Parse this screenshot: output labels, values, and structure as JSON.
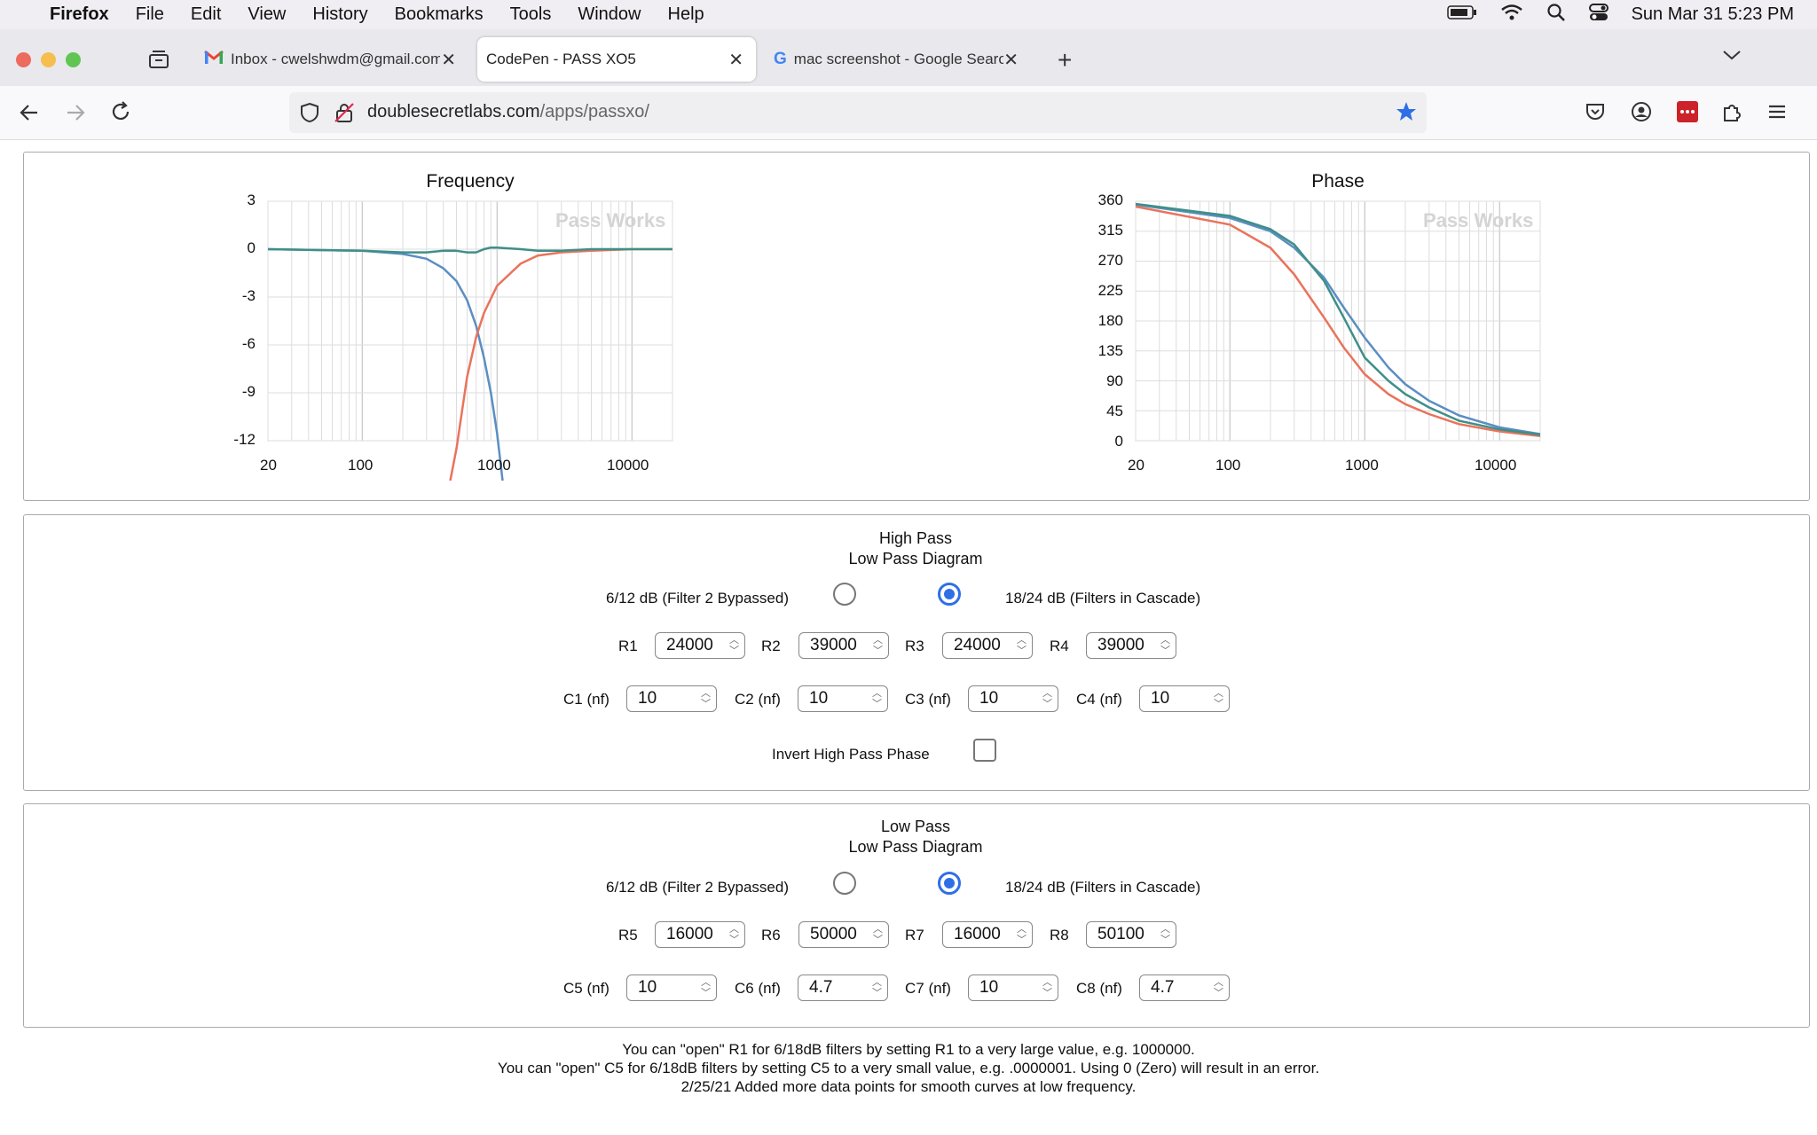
{
  "menubar": {
    "app": "Firefox",
    "items": [
      "File",
      "Edit",
      "View",
      "History",
      "Bookmarks",
      "Tools",
      "Window",
      "Help"
    ],
    "clock": "Sun Mar 31  5:23 PM"
  },
  "tabs": [
    {
      "label": "Inbox - cwelshwdm@gmail.com"
    },
    {
      "label": "CodePen - PASS XO5"
    },
    {
      "label": "mac screenshot - Google Search"
    }
  ],
  "url": {
    "host": "doublesecretlabs.com",
    "path": "/apps/passxo/"
  },
  "charts": {
    "watermark": "Pass Works",
    "frequency": {
      "title": "Frequency",
      "yticks": [
        "3",
        "0",
        "-3",
        "-6",
        "-9",
        "-12"
      ],
      "xticks": [
        "20",
        "100",
        "1000",
        "10000"
      ]
    },
    "phase": {
      "title": "Phase",
      "yticks": [
        "360",
        "315",
        "270",
        "225",
        "180",
        "135",
        "90",
        "45",
        "0"
      ],
      "xticks": [
        "20",
        "100",
        "1000",
        "10000"
      ]
    }
  },
  "chart_data": [
    {
      "type": "line",
      "title": "Frequency",
      "xscale": "log",
      "xlim": [
        20,
        20000
      ],
      "ylim": [
        -12,
        3
      ],
      "series": [
        {
          "color": "#5b8ec2",
          "x": [
            20,
            100,
            200,
            300,
            400,
            500,
            600,
            700,
            800,
            900,
            1000,
            1100
          ],
          "y": [
            0,
            -0.1,
            -0.3,
            -0.6,
            -1.2,
            -2.0,
            -3.2,
            -4.8,
            -6.8,
            -9.0,
            -11.5,
            -14.5
          ]
        },
        {
          "color": "#e9735c",
          "x": [
            450,
            500,
            600,
            700,
            800,
            1000,
            1500,
            2000,
            3000,
            5000,
            10000,
            20000
          ],
          "y": [
            -14.5,
            -12.5,
            -8.0,
            -5.5,
            -4.0,
            -2.3,
            -0.9,
            -0.4,
            -0.2,
            -0.1,
            0,
            0
          ]
        },
        {
          "color": "#3f8f88",
          "x": [
            20,
            100,
            200,
            300,
            400,
            500,
            600,
            700,
            800,
            900,
            1000,
            1500,
            2000,
            3000,
            5000,
            10000,
            20000
          ],
          "y": [
            0,
            -0.1,
            -0.2,
            -0.2,
            -0.1,
            -0.1,
            -0.2,
            -0.2,
            0,
            0.1,
            0.1,
            0,
            -0.1,
            -0.1,
            0,
            0,
            0
          ]
        }
      ],
      "grid": true
    },
    {
      "type": "line",
      "title": "Phase",
      "xscale": "log",
      "xlim": [
        20,
        20000
      ],
      "ylim": [
        0,
        360
      ],
      "series": [
        {
          "color": "#5b8ec2",
          "x": [
            20,
            100,
            200,
            300,
            500,
            700,
            1000,
            1500,
            2000,
            3000,
            5000,
            10000,
            20000
          ],
          "y": [
            355,
            335,
            315,
            290,
            245,
            200,
            155,
            110,
            85,
            60,
            38,
            20,
            10
          ]
        },
        {
          "color": "#e9735c",
          "x": [
            20,
            100,
            200,
            300,
            500,
            700,
            1000,
            1500,
            2000,
            3000,
            5000,
            10000,
            20000
          ],
          "y": [
            352,
            325,
            290,
            250,
            185,
            140,
            100,
            70,
            55,
            40,
            25,
            14,
            7
          ]
        },
        {
          "color": "#3f8f88",
          "x": [
            20,
            100,
            200,
            300,
            500,
            700,
            1000,
            1500,
            2000,
            3000,
            5000,
            10000,
            20000
          ],
          "y": [
            356,
            338,
            318,
            295,
            240,
            185,
            125,
            90,
            70,
            50,
            30,
            17,
            9
          ]
        }
      ],
      "grid": true
    }
  ],
  "highpass": {
    "title": "High Pass",
    "subtitle": "Low Pass Diagram",
    "option1": "6/12 dB (Filter 2 Bypassed)",
    "option2": "18/24 dB (Filters in Cascade)",
    "selected": "option2",
    "resistors": [
      {
        "label": "R1",
        "value": "24000"
      },
      {
        "label": "R2",
        "value": "39000"
      },
      {
        "label": "R3",
        "value": "24000"
      },
      {
        "label": "R4",
        "value": "39000"
      }
    ],
    "capacitors": [
      {
        "label": "C1 (nf)",
        "value": "10"
      },
      {
        "label": "C2 (nf)",
        "value": "10"
      },
      {
        "label": "C3 (nf)",
        "value": "10"
      },
      {
        "label": "C4 (nf)",
        "value": "10"
      }
    ],
    "invert_label": "Invert High Pass Phase"
  },
  "lowpass": {
    "title": "Low Pass",
    "subtitle": "Low Pass Diagram",
    "option1": "6/12 dB (Filter 2 Bypassed)",
    "option2": "18/24 dB (Filters in Cascade)",
    "selected": "option2",
    "resistors": [
      {
        "label": "R5",
        "value": "16000"
      },
      {
        "label": "R6",
        "value": "50000"
      },
      {
        "label": "R7",
        "value": "16000"
      },
      {
        "label": "R8",
        "value": "50100"
      }
    ],
    "capacitors": [
      {
        "label": "C5 (nf)",
        "value": "10"
      },
      {
        "label": "C6 (nf)",
        "value": "4.7"
      },
      {
        "label": "C7 (nf)",
        "value": "10"
      },
      {
        "label": "C8 (nf)",
        "value": "4.7"
      }
    ]
  },
  "notes": [
    "You can \"open\" R1 for 6/18dB filters by setting R1 to a very large value, e.g. 1000000.",
    "You can \"open\" C5 for 6/18dB filters by setting C5 to a very small value, e.g. .0000001. Using 0 (Zero) will result in an error.",
    "2/25/21 Added more data points for smooth curves at low frequency."
  ]
}
